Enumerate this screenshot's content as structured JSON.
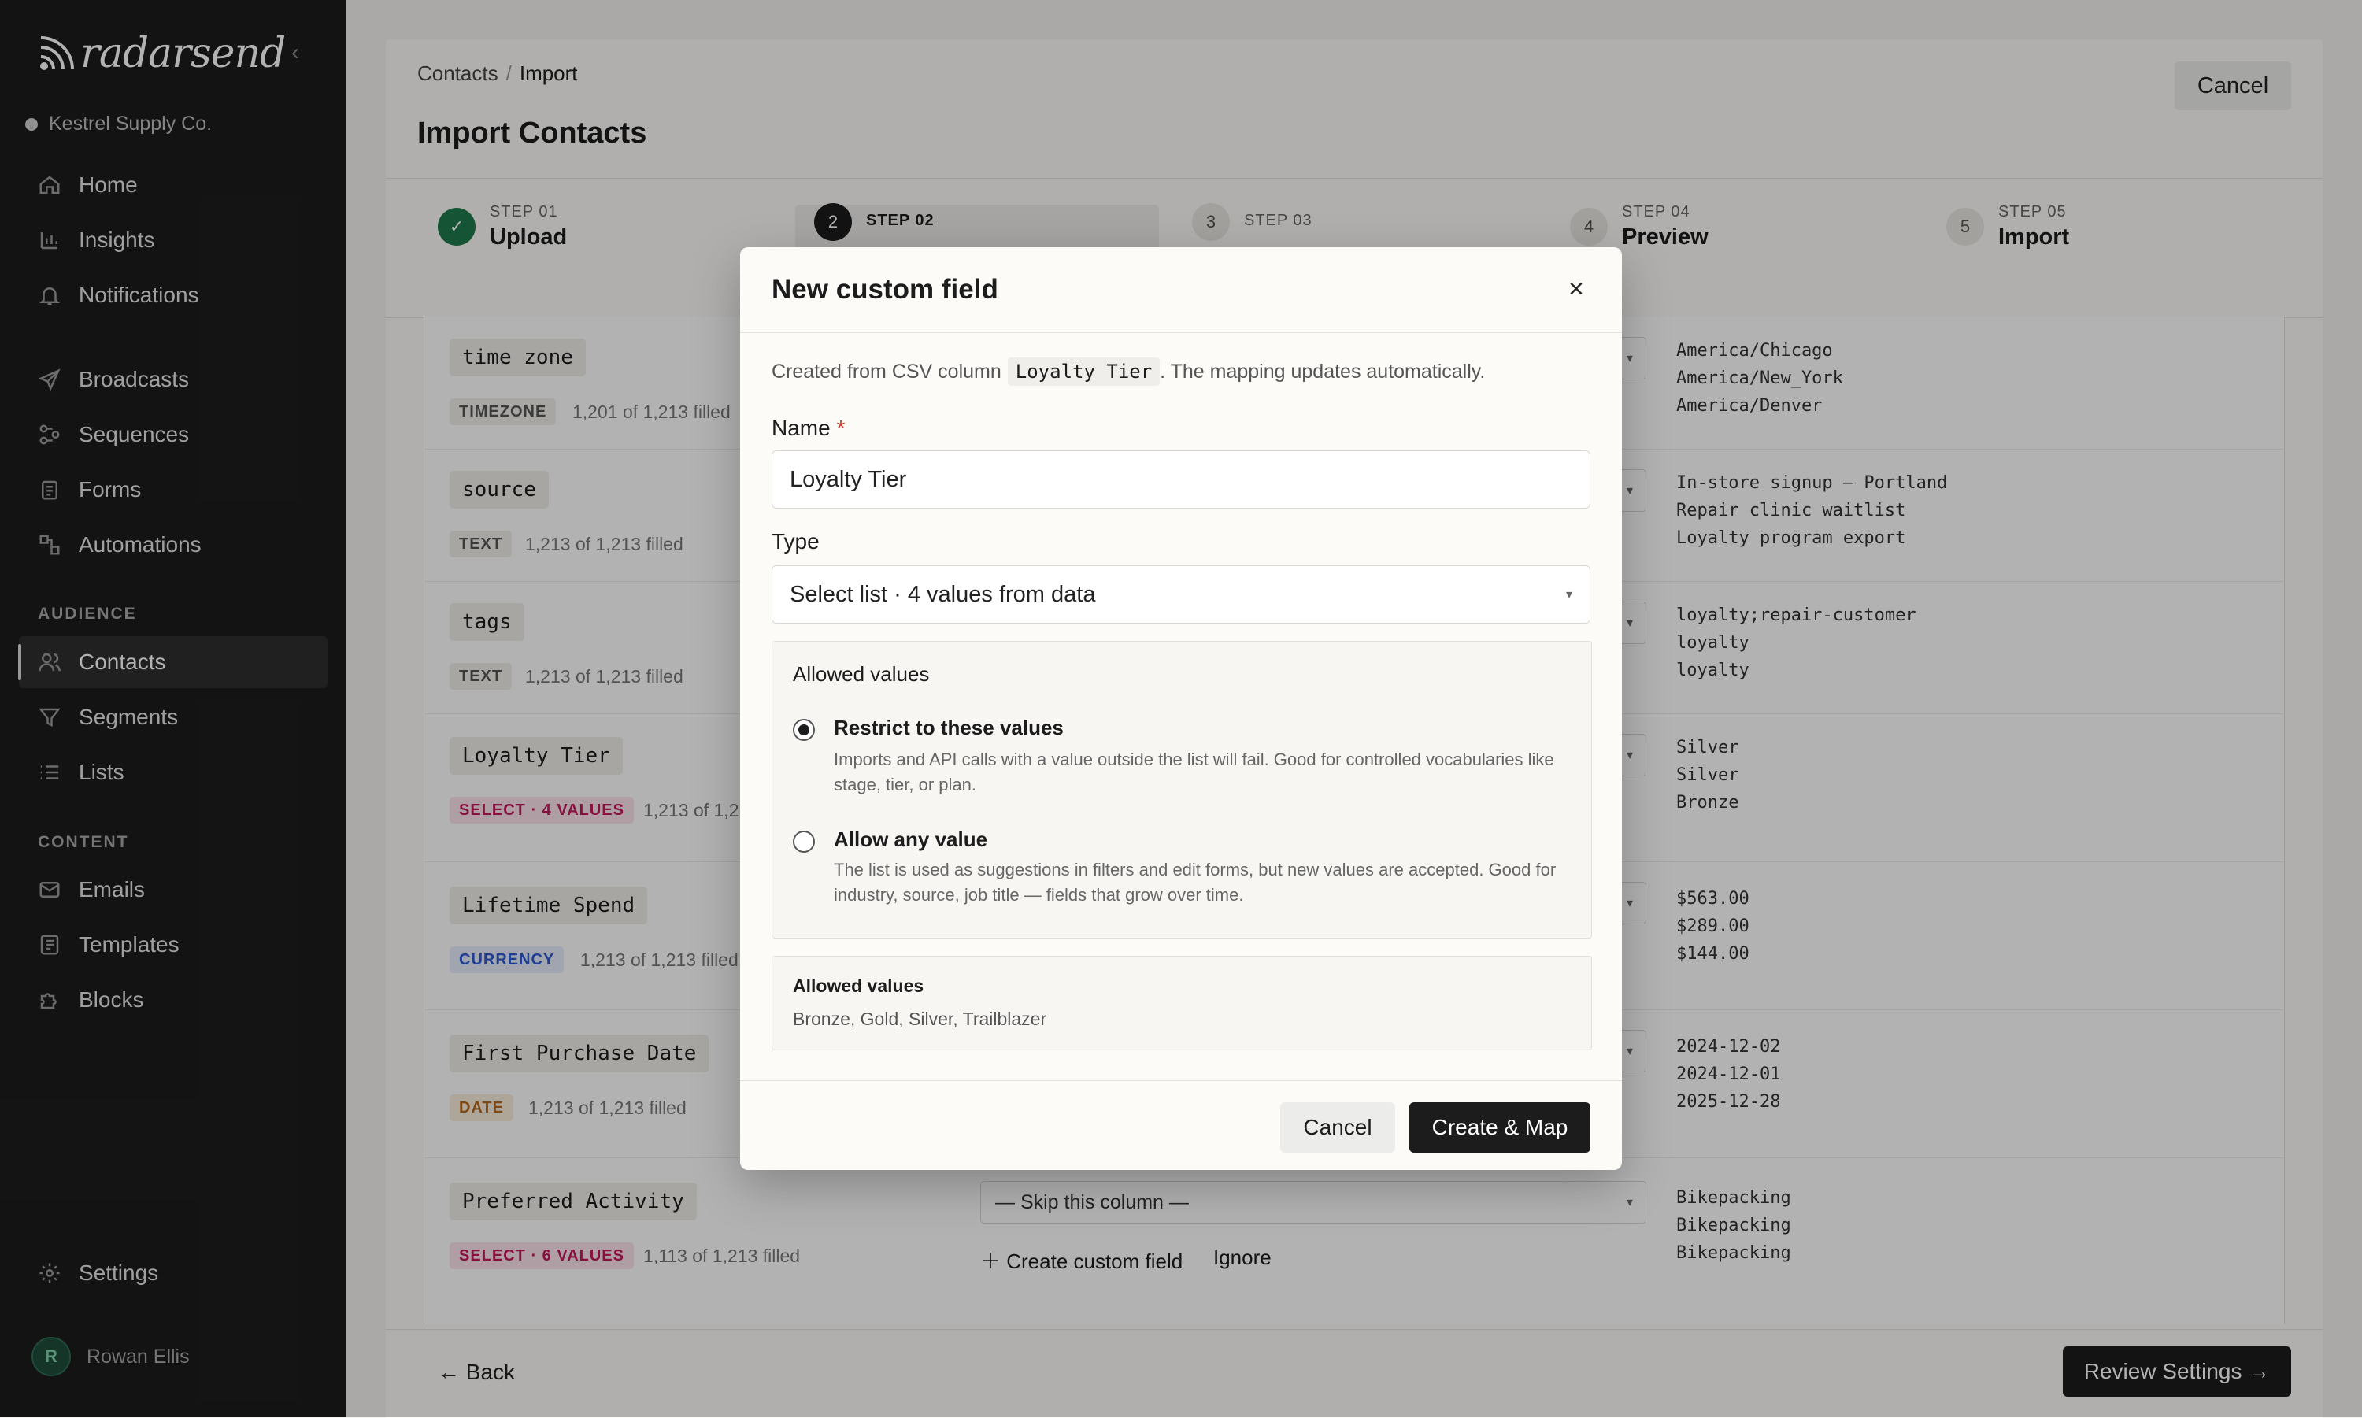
{
  "sidebar": {
    "logo": "radarsend",
    "org": "Kestrel Supply Co.",
    "main_items": [
      {
        "label": "Home",
        "icon": "home-icon"
      },
      {
        "label": "Insights",
        "icon": "bar-chart-icon"
      },
      {
        "label": "Notifications",
        "icon": "bell-icon"
      }
    ],
    "send_items": [
      {
        "label": "Broadcasts",
        "icon": "send-icon"
      },
      {
        "label": "Sequences",
        "icon": "sequence-icon"
      },
      {
        "label": "Forms",
        "icon": "clipboard-icon"
      },
      {
        "label": "Automations",
        "icon": "flow-icon"
      }
    ],
    "audience_label": "AUDIENCE",
    "audience_items": [
      {
        "label": "Contacts",
        "icon": "users-icon",
        "active": true
      },
      {
        "label": "Segments",
        "icon": "filter-icon"
      },
      {
        "label": "Lists",
        "icon": "list-icon"
      }
    ],
    "content_label": "CONTENT",
    "content_items": [
      {
        "label": "Emails",
        "icon": "mail-icon"
      },
      {
        "label": "Templates",
        "icon": "template-icon"
      },
      {
        "label": "Blocks",
        "icon": "puzzle-icon"
      }
    ],
    "settings": "Settings",
    "user": {
      "initial": "R",
      "name": "Rowan Ellis"
    }
  },
  "header": {
    "breadcrumb": [
      "Contacts",
      "Import"
    ],
    "title": "Import Contacts",
    "cancel": "Cancel"
  },
  "steps": [
    {
      "label": "STEP 01",
      "name": "Upload",
      "state": "done",
      "num": "✓"
    },
    {
      "label": "STEP 02",
      "name": "",
      "state": "current",
      "num": "2"
    },
    {
      "label": "STEP 03",
      "name": "",
      "state": "todo",
      "num": "3"
    },
    {
      "label": "STEP 04",
      "name": "Preview",
      "state": "todo",
      "num": "4"
    },
    {
      "label": "STEP 05",
      "name": "Import",
      "state": "todo",
      "num": "5"
    }
  ],
  "fields": [
    {
      "name": "time zone",
      "type": "TIMEZONE",
      "fill": "1,201 of 1,213 filled",
      "samples": [
        "America/Chicago",
        "America/New_York",
        "America/Denver"
      ]
    },
    {
      "name": "source",
      "type": "TEXT",
      "fill": "1,213 of 1,213 filled",
      "samples": [
        "In-store signup — Portland",
        "Repair clinic waitlist",
        "Loyalty program export"
      ]
    },
    {
      "name": "tags",
      "type": "TEXT",
      "fill": "1,213 of 1,213 filled",
      "samples": [
        "loyalty;repair-customer",
        "loyalty",
        "loyalty"
      ]
    },
    {
      "name": "Loyalty Tier",
      "type": "SELECT · 4 VALUES",
      "fill": "1,213 of 1,2",
      "samples": [
        "Silver",
        "Silver",
        "Bronze"
      ]
    },
    {
      "name": "Lifetime Spend",
      "type": "CURRENCY",
      "fill": "1,213 of 1,213 filled",
      "samples": [
        "$563.00",
        "$289.00",
        "$144.00"
      ]
    },
    {
      "name": "First Purchase Date",
      "type": "DATE",
      "fill": "1,213 of 1,213 filled",
      "samples": [
        "2024-12-02",
        "2024-12-01",
        "2025-12-28"
      ]
    },
    {
      "name": "Preferred Activity",
      "type": "SELECT · 6 VALUES",
      "fill": "1,113 of 1,213 filled",
      "samples": [
        "Bikepacking",
        "Bikepacking",
        "Bikepacking"
      ]
    }
  ],
  "row_actions": {
    "skip": "— Skip this column —",
    "create": "Create custom field",
    "ignore": "Ignore"
  },
  "footer": {
    "back": "← Back",
    "review": "Review Settings →"
  },
  "modal": {
    "title": "New custom field",
    "desc_prefix": "Created from CSV column",
    "desc_column": "Loyalty Tier",
    "desc_suffix": ". The mapping updates automatically.",
    "name_label": "Name",
    "required_mark": "*",
    "name_value": "Loyalty Tier",
    "type_label": "Type",
    "type_value": "Select list · 4 values from data",
    "panel_title": "Allowed values",
    "options": [
      {
        "title": "Restrict to these values",
        "desc": "Imports and API calls with a value outside the list will fail. Good for controlled vocabularies like stage, tier, or plan.",
        "selected": true
      },
      {
        "title": "Allow any value",
        "desc": "The list is used as suggestions in filters and edit forms, but new values are accepted. Good for industry, source, job title — fields that grow over time.",
        "selected": false
      }
    ],
    "values_title": "Allowed values",
    "values_list": "Bronze, Gold, Silver, Trailblazer",
    "cancel": "Cancel",
    "create": "Create & Map"
  },
  "colors": {
    "sidebar": "#1c1c1c",
    "accent": "#1c1c1c",
    "success": "#1f7a4d",
    "select_badge": "#c2185b",
    "currency_badge": "#2f5bd3",
    "date_badge": "#b8691c"
  }
}
